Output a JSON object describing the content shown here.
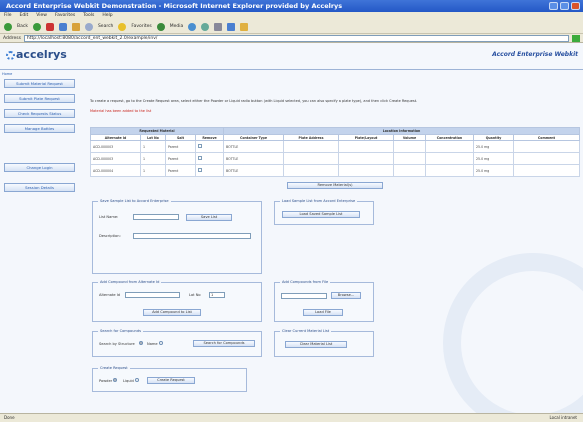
{
  "window": {
    "title": "Accord Enterprise Webkit Demonstration - Microsoft Internet Explorer provided by Accelrys"
  },
  "menu": [
    "File",
    "Edit",
    "View",
    "Favorites",
    "Tools",
    "Help"
  ],
  "toolbar": {
    "back": "Back",
    "search": "Search",
    "favorites": "Favorites",
    "media": "Media"
  },
  "address": {
    "label": "Address",
    "url": "http://localhost:8080/accord_ent_webkit_2.0/example/inv/"
  },
  "header": {
    "logo": "accelrys",
    "brand": "Accord Enterprise Webkit"
  },
  "sidebar": {
    "home": "Home",
    "items": [
      "Submit Material Request",
      "Submit Plate Request",
      "Check Requests Status",
      "Manage Bottles",
      "Change Login",
      "Session Details"
    ]
  },
  "instructions": "To create a request, go to the Create Request area, select either the Powder or Liquid radio button (with Liquid selected, you can also specify a plate type), and then click Create Request.",
  "status_message": "Material has been added to the list",
  "table": {
    "group_requested": "Requested Material",
    "group_location": "Location Information",
    "headers": [
      "Alternate Id",
      "Lot No",
      "Salt",
      "Remove",
      "Container Type",
      "Plate Address",
      "Plate/Layout",
      "Volume",
      "Concentration",
      "Quantity",
      "Comment"
    ],
    "rows": [
      {
        "alt_id": "ACD-000003",
        "lot": "1",
        "salt": "Parent",
        "container": "BOTTLE",
        "quantity": "25.0 mg"
      },
      {
        "alt_id": "ACD-000003",
        "lot": "1",
        "salt": "Parent",
        "container": "BOTTLE",
        "quantity": "25.0 mg"
      },
      {
        "alt_id": "ACD-000004",
        "lot": "1",
        "salt": "Parent",
        "container": "BOTTLE",
        "quantity": "25.0 mg"
      }
    ]
  },
  "remove_button": "Remove Material(s)",
  "panels": {
    "save": {
      "legend": "Save Sample List to Accord Enterprise",
      "list_name": "List Name:",
      "description": "Description:",
      "button": "Save List"
    },
    "load": {
      "legend": "Load Sample List from Accord Enterprise",
      "button": "Load Saved Sample List"
    },
    "add_alt": {
      "legend": "Add Compound from Alternate Id",
      "alt_id": "Alternate Id",
      "lot_no": "Lot No",
      "lot_value": "1",
      "button": "Add Compound to List"
    },
    "add_file": {
      "legend": "Add Compounds from File",
      "browse": "Browse...",
      "button": "Load File"
    },
    "search": {
      "legend": "Search for Compounds",
      "by_structure": "Search by Structure",
      "name": "Name",
      "button": "Search for Compounds"
    },
    "clear": {
      "legend": "Clear Current Material List",
      "button": "Clear Material List"
    },
    "create": {
      "legend": "Create Request",
      "powder": "Powder",
      "liquid": "Liquid",
      "button": "Create Request"
    }
  },
  "statusbar": {
    "left": "Done",
    "zone": "Local intranet"
  }
}
